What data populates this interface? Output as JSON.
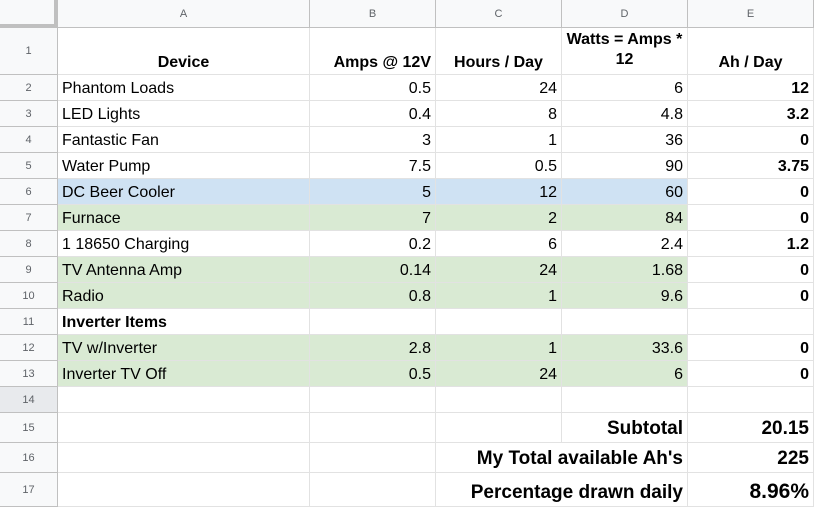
{
  "column_headers": [
    "A",
    "B",
    "C",
    "D",
    "E"
  ],
  "row_numbers": [
    "1",
    "2",
    "3",
    "4",
    "5",
    "6",
    "7",
    "8",
    "9",
    "10",
    "11",
    "12",
    "13",
    "14",
    "15",
    "16",
    "17"
  ],
  "header_row": {
    "device": "Device",
    "amps": "Amps @ 12V",
    "hours": "Hours / Day",
    "watts": "Watts = Amps * 12",
    "ah": "Ah / Day"
  },
  "rows": [
    {
      "device": "Phantom Loads",
      "amps": "0.5",
      "hours": "24",
      "watts": "6",
      "ah": "12",
      "fill": "none"
    },
    {
      "device": "LED Lights",
      "amps": "0.4",
      "hours": "8",
      "watts": "4.8",
      "ah": "3.2",
      "fill": "none"
    },
    {
      "device": "Fantastic Fan",
      "amps": "3",
      "hours": "1",
      "watts": "36",
      "ah": "0",
      "fill": "none"
    },
    {
      "device": "Water Pump",
      "amps": "7.5",
      "hours": "0.5",
      "watts": "90",
      "ah": "3.75",
      "fill": "none"
    },
    {
      "device": "DC Beer Cooler",
      "amps": "5",
      "hours": "12",
      "watts": "60",
      "ah": "0",
      "fill": "blue"
    },
    {
      "device": "Furnace",
      "amps": "7",
      "hours": "2",
      "watts": "84",
      "ah": "0",
      "fill": "green"
    },
    {
      "device": "1 18650 Charging",
      "amps": "0.2",
      "hours": "6",
      "watts": "2.4",
      "ah": "1.2",
      "fill": "none"
    },
    {
      "device": "TV Antenna Amp",
      "amps": "0.14",
      "hours": "24",
      "watts": "1.68",
      "ah": "0",
      "fill": "green"
    },
    {
      "device": "Radio",
      "amps": "0.8",
      "hours": "1",
      "watts": "9.6",
      "ah": "0",
      "fill": "green"
    }
  ],
  "inverter_label": "Inverter Items",
  "inverter_rows": [
    {
      "device": "TV w/Inverter",
      "amps": "2.8",
      "hours": "1",
      "watts": "33.6",
      "ah": "0",
      "fill": "green"
    },
    {
      "device": "Inverter TV Off",
      "amps": "0.5",
      "hours": "24",
      "watts": "6",
      "ah": "0",
      "fill": "green"
    }
  ],
  "summary": {
    "subtotal_label": "Subtotal",
    "subtotal_value": "20.15",
    "available_label": "My Total available Ah's",
    "available_value": "225",
    "percent_label": "Percentage drawn daily",
    "percent_value": "8.96%"
  },
  "colors": {
    "blue_fill": "#cfe2f3",
    "green_fill": "#d9ead3",
    "header_bg": "#f8f9fa"
  }
}
